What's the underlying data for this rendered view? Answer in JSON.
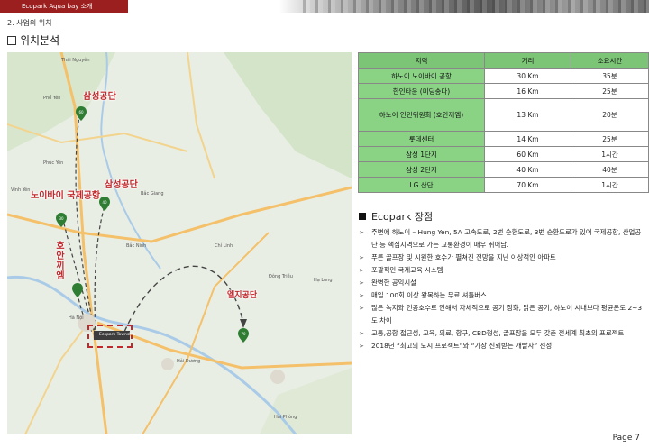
{
  "header": {
    "tab_label": "Ecopark Aqua bay 소개",
    "section_title": "2.  사업의 위치",
    "sub_title": "위치분석"
  },
  "map": {
    "markers": {
      "samsung_1": "삼성공단",
      "samsung_2": "삼성공단",
      "noibai": "노이바이 국제공항",
      "hoankiem": "호안끼엠",
      "lg": "엘지공단",
      "ecopark": "Ecopark Township"
    },
    "place_labels": [
      "Thái Nguyên",
      "Phổ Yên",
      "Phúc Yên",
      "Vĩnh Yên",
      "Bắc Giang",
      "Bắc Ninh",
      "Chí Linh",
      "Hà Nội",
      "Hải Dương",
      "Hải Phòng",
      "Hạ Long",
      "Đông Triều"
    ],
    "pin_numbers": [
      "60",
      "40",
      "30",
      "70"
    ]
  },
  "table": {
    "headers": [
      "지역",
      "거리",
      "소요시간"
    ],
    "rows": [
      {
        "region": "하노이 노이바이 공항",
        "distance": "30 Km",
        "time": "35분"
      },
      {
        "region": "한인타운 (미딩송다)",
        "distance": "16 Km",
        "time": "25분"
      },
      {
        "region": "하노이 인민위원회 (호안끼엠)",
        "distance": "13 Km",
        "time": "20분"
      },
      {
        "region": "롯데센터",
        "distance": "14 Km",
        "time": "25분"
      },
      {
        "region": "삼성 1단지",
        "distance": "60 Km",
        "time": "1시간"
      },
      {
        "region": "삼성 2단지",
        "distance": "40 Km",
        "time": "40분"
      },
      {
        "region": "LG 산단",
        "distance": "70 Km",
        "time": "1시간"
      }
    ]
  },
  "merits": {
    "title": "Ecopark 장점",
    "items": [
      "주변에 하노이 – Hung Yen, 5A 고속도로, 2번 순환도로, 3번 순환도로가 있어 국제공항, 산업공단 등 핵심지역으로 가는 교통환경이 매우 뛰어남.",
      "푸른 골프장 및 시원한 호수가 펼쳐진 전망을 지닌 이상적인 아파트",
      "포괄적인 국제교육 시스템",
      "완벽한 공익시설",
      "매일 100회 이상 왕복하는 무료 셔틀버스",
      "많은 녹지와 인공호수로 인해서 자체적으로 공기 정화, 맑은 공기, 하노이 시내보다 평균온도 2~3도 차이",
      "교통,공항 접근성, 교육, 의료, 항구, CBD형성, 골프장을 모두 갖춘 전세계 최초의 프로젝트",
      "2018년 “최고의 도시 프로젝트”와 “가장 신뢰받는 개발자” 선정"
    ]
  },
  "footer": {
    "page": "Page 7"
  },
  "colors": {
    "accent_red": "#c0282c",
    "table_green": "#7cc576",
    "banner_red": "#9c1f1f"
  },
  "icons": [
    "checkbox-icon",
    "square-bullet-icon",
    "arrow-bullet-icon",
    "map-pin-icon"
  ]
}
